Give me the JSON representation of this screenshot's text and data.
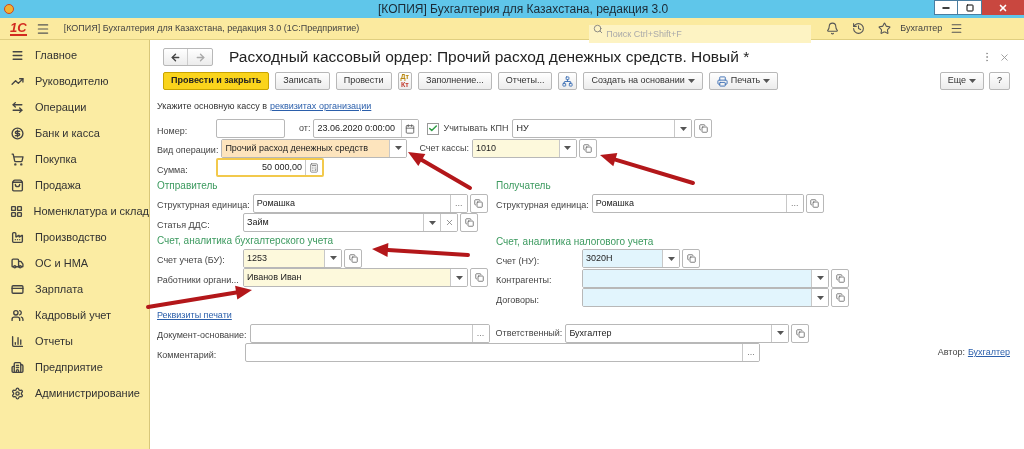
{
  "window": {
    "title": "[КОПИЯ] Бухгалтерия для Казахстана, редакция 3.0"
  },
  "app_header": {
    "logo": "1С",
    "title": "[КОПИЯ] Бухгалтерия для Казахстана, редакция 3.0  (1С:Предприятие)",
    "search": {
      "placeholder": "Поиск Ctrl+Shift+F"
    },
    "user": "Бухгалтер"
  },
  "sidebar": {
    "items": [
      {
        "label": "Главное"
      },
      {
        "label": "Руководителю"
      },
      {
        "label": "Операции"
      },
      {
        "label": "Банк и касса"
      },
      {
        "label": "Покупка"
      },
      {
        "label": "Продажа"
      },
      {
        "label": "Номенклатура и склад"
      },
      {
        "label": "Производство"
      },
      {
        "label": "ОС и НМА"
      },
      {
        "label": "Зарплата"
      },
      {
        "label": "Кадровый учет"
      },
      {
        "label": "Отчеты"
      },
      {
        "label": "Предприятие"
      },
      {
        "label": "Администрирование"
      }
    ]
  },
  "document": {
    "title": "Расходный кассовый ордер: Прочий расход денежных средств. Новый *",
    "toolbar": [
      {
        "kind": "primary",
        "label": "Провести и закрыть"
      },
      {
        "kind": "button",
        "label": "Записать"
      },
      {
        "kind": "button",
        "label": "Провести"
      },
      {
        "kind": "dtkt",
        "icon_text": [
          "Дт",
          "Кт"
        ]
      },
      {
        "kind": "button",
        "label": "Заполнение..."
      },
      {
        "kind": "button",
        "label": "Отчеты..."
      },
      {
        "kind": "structure"
      },
      {
        "kind": "dropdown",
        "label": "Создать на основании"
      },
      {
        "kind": "print",
        "label": "Печать"
      }
    ],
    "toolbar_right": [
      {
        "kind": "dropdown",
        "label": "Еще"
      },
      {
        "kind": "button",
        "label": "?"
      }
    ],
    "hint": {
      "text": "Укажите основную кассу в",
      "link": "реквизитах организации"
    },
    "number": {
      "label": "Номер:"
    },
    "date": {
      "label": "от:",
      "value": "23.06.2020  0:00:00"
    },
    "kpn": {
      "label": "Учитывать КПН",
      "checked": true
    },
    "kpn_mode": {
      "value": "НУ"
    },
    "operation": {
      "label": "Вид операции:",
      "value": "Прочий расход денежных средств"
    },
    "cash_account": {
      "label": "Счет кассы:",
      "value": "1010"
    },
    "amount": {
      "label": "Сумма:",
      "value": "50 000,00",
      "focused": true
    },
    "sender": {
      "heading": "Отправитель",
      "unit": {
        "label": "Структурная единица:",
        "value": "Ромашка",
        "choice": "..."
      },
      "dds": {
        "label": "Статья ДДС:",
        "value": "Займ"
      }
    },
    "receiver": {
      "heading": "Получатель",
      "unit": {
        "label": "Структурная единица:",
        "value": "Ромашка",
        "choice": "..."
      }
    },
    "accounting": {
      "heading": "Счет, аналитика бухгалтерского учета",
      "account": {
        "label": "Счет учета (БУ):",
        "value": "1253"
      },
      "workers": {
        "label": "Работники органи...",
        "value": "Иванов Иван"
      }
    },
    "tax": {
      "heading": "Счет, аналитика налогового учета",
      "account": {
        "label": "Счет (НУ):",
        "value": "3020Н"
      },
      "counterparties": {
        "label": "Контрагенты:"
      },
      "contracts": {
        "label": "Договоры:"
      }
    },
    "print_link": "Реквизиты печати",
    "basis": {
      "label": "Документ-основание:",
      "choice": "..."
    },
    "responsible": {
      "label": "Ответственный:",
      "value": "Бухгалтер"
    },
    "comment": {
      "label": "Комментарий:",
      "choice": "..."
    },
    "author": {
      "label": "Автор:",
      "link": "Бухгалтер"
    }
  }
}
